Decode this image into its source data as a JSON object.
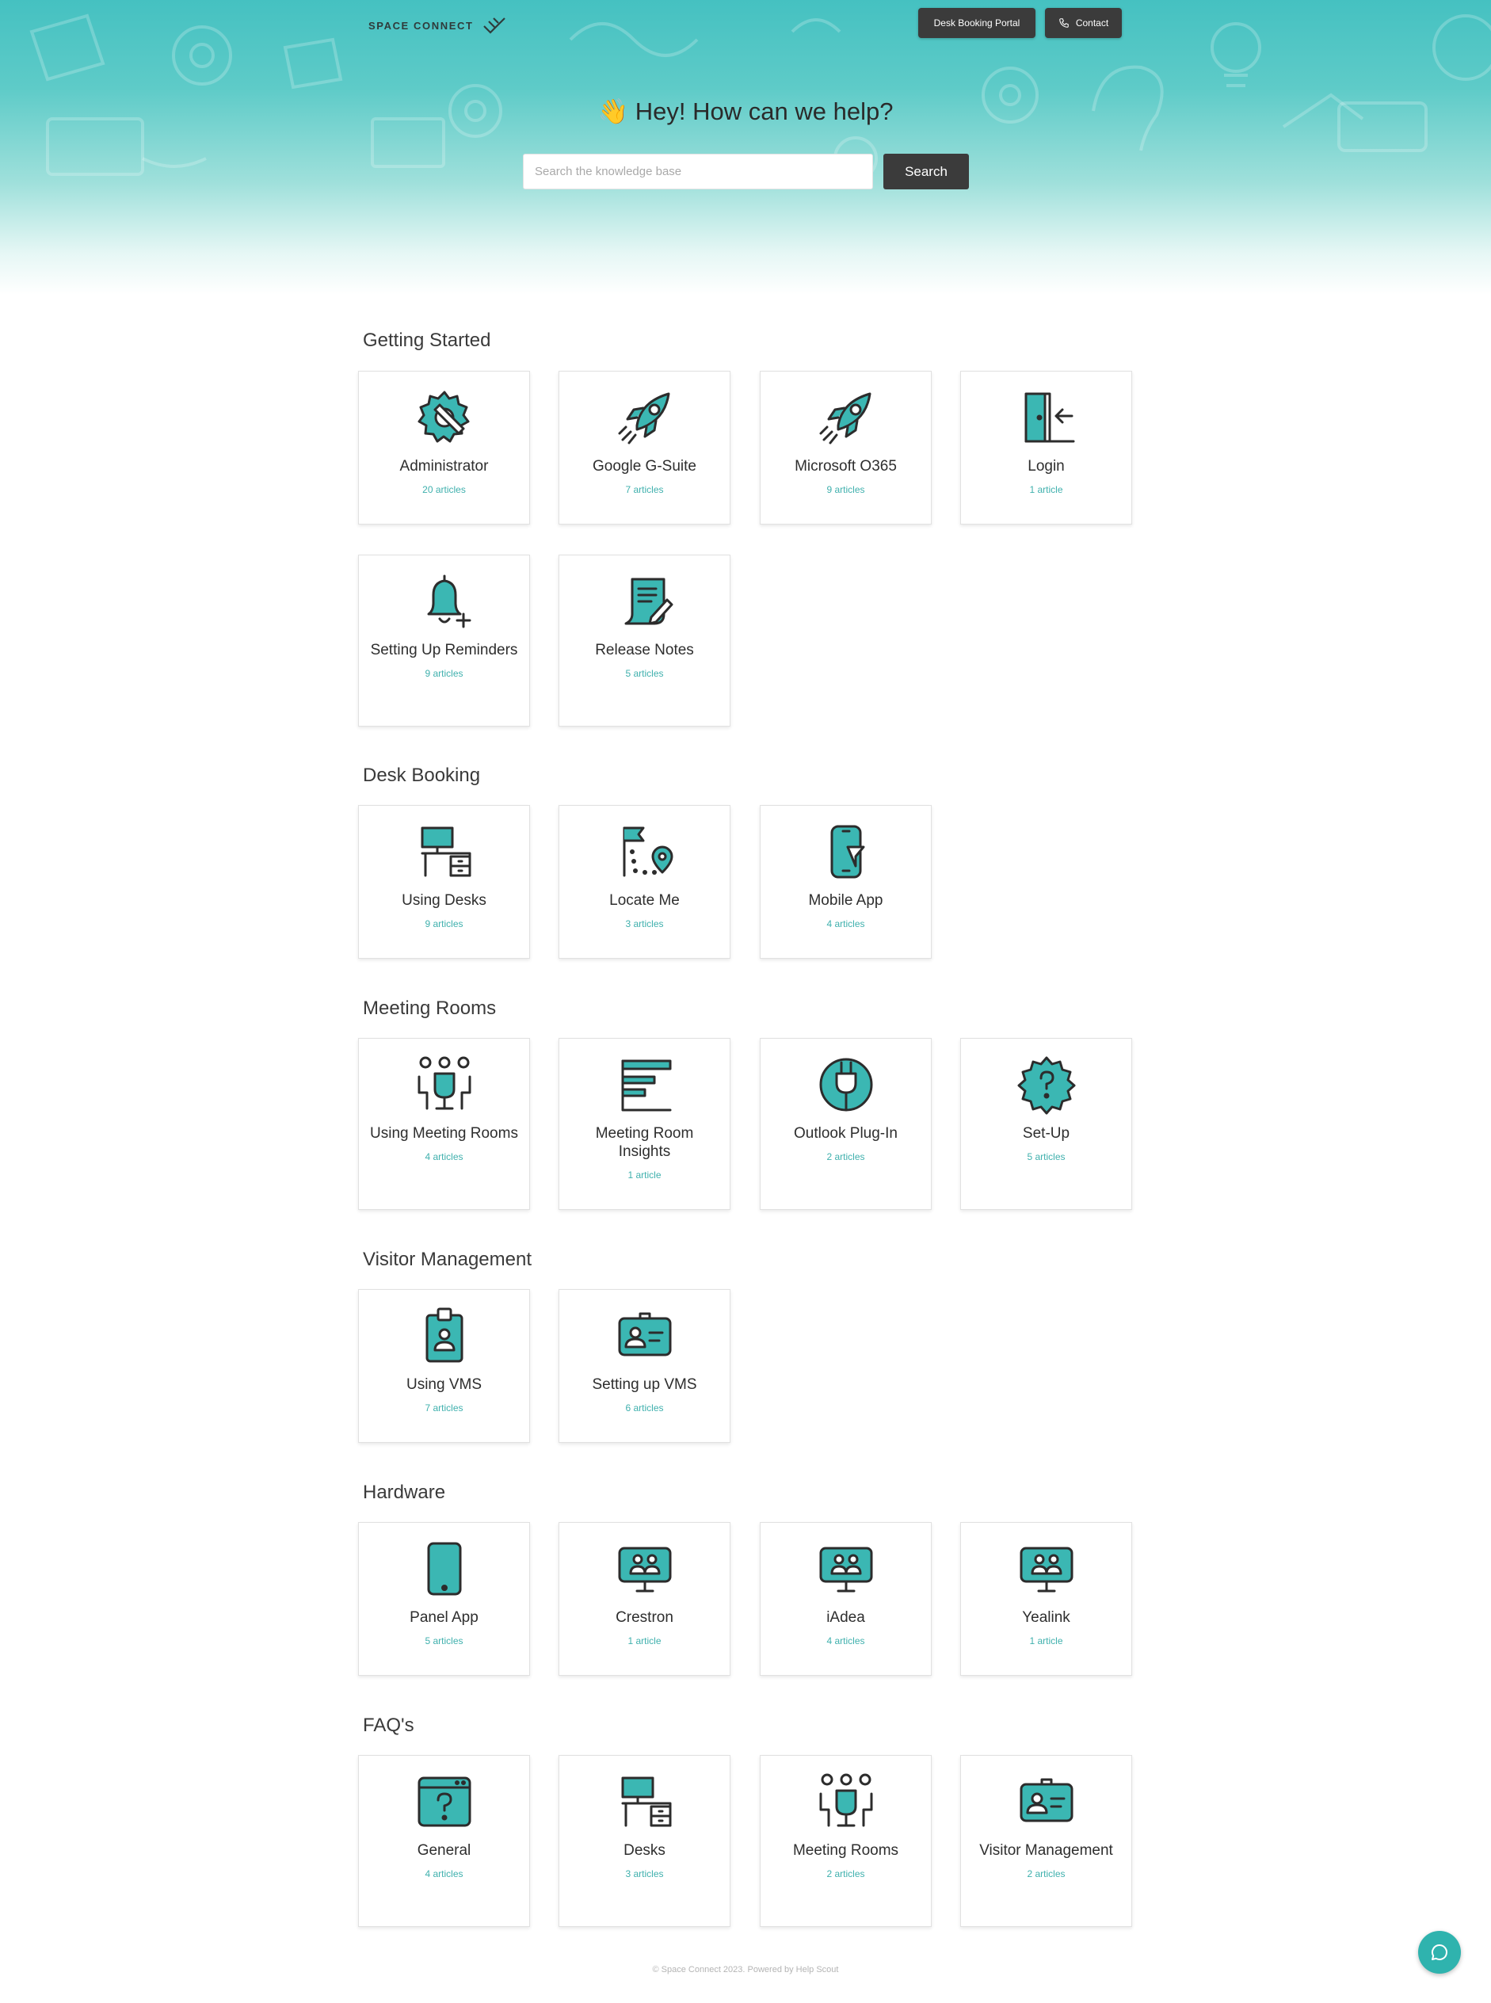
{
  "brand": {
    "logo_text": "SPACE CONNECT"
  },
  "header": {
    "desk_booking_label": "Desk Booking Portal",
    "contact_label": "Contact"
  },
  "hero": {
    "emoji": "👋",
    "headline": "Hey! How can we help?",
    "search_placeholder": "Search the knowledge base",
    "search_button": "Search"
  },
  "colors": {
    "accent": "#3bb7b3",
    "dark": "#3b3b3b",
    "count_text": "#3fb0ad"
  },
  "sections": [
    {
      "title": "Getting Started",
      "cards": [
        {
          "title": "Administrator",
          "count": "20 articles",
          "icon": "gear-wrench-icon"
        },
        {
          "title": "Google G-Suite",
          "count": "7 articles",
          "icon": "rocket-icon"
        },
        {
          "title": "Microsoft O365",
          "count": "9 articles",
          "icon": "rocket-icon"
        },
        {
          "title": "Login",
          "count": "1 article",
          "icon": "door-login-icon"
        },
        {
          "title": "Setting Up Reminders",
          "count": "9 articles",
          "icon": "bell-plus-icon"
        },
        {
          "title": "Release Notes",
          "count": "5 articles",
          "icon": "scroll-pen-icon"
        }
      ]
    },
    {
      "title": "Desk Booking",
      "cards": [
        {
          "title": "Using Desks",
          "count": "9 articles",
          "icon": "desk-icon"
        },
        {
          "title": "Locate Me",
          "count": "3 articles",
          "icon": "location-path-icon"
        },
        {
          "title": "Mobile App",
          "count": "4 articles",
          "icon": "mobile-app-icon"
        }
      ]
    },
    {
      "title": "Meeting Rooms",
      "cards": [
        {
          "title": "Using Meeting Rooms",
          "count": "4 articles",
          "icon": "meeting-people-icon"
        },
        {
          "title": "Meeting Room Insights",
          "count": "1 article",
          "icon": "insights-lines-icon"
        },
        {
          "title": "Outlook Plug-In",
          "count": "2 articles",
          "icon": "plug-icon"
        },
        {
          "title": "Set-Up",
          "count": "5 articles",
          "icon": "gear-question-icon"
        }
      ]
    },
    {
      "title": "Visitor Management",
      "cards": [
        {
          "title": "Using VMS",
          "count": "7 articles",
          "icon": "id-badge-icon"
        },
        {
          "title": "Setting up VMS",
          "count": "6 articles",
          "icon": "id-card-icon"
        }
      ]
    },
    {
      "title": "Hardware",
      "cards": [
        {
          "title": "Panel App",
          "count": "5 articles",
          "icon": "tablet-icon"
        },
        {
          "title": "Crestron",
          "count": "1 article",
          "icon": "monitor-people-icon"
        },
        {
          "title": "iAdea",
          "count": "4 articles",
          "icon": "monitor-people-icon"
        },
        {
          "title": "Yealink",
          "count": "1 article",
          "icon": "monitor-people-icon"
        }
      ]
    },
    {
      "title": "FAQ's",
      "cards": [
        {
          "title": "General",
          "count": "4 articles",
          "icon": "browser-question-icon"
        },
        {
          "title": "Desks",
          "count": "3 articles",
          "icon": "desk-icon"
        },
        {
          "title": "Meeting Rooms",
          "count": "2 articles",
          "icon": "meeting-people-icon"
        },
        {
          "title": "Visitor Management",
          "count": "2 articles",
          "icon": "id-card-icon"
        }
      ]
    }
  ],
  "footer": {
    "text": "© Space Connect 2023. Powered by Help Scout"
  }
}
